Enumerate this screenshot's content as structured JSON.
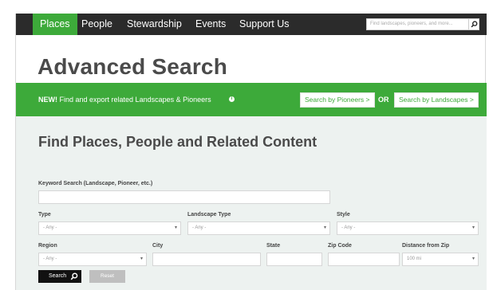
{
  "nav": {
    "items": [
      {
        "label": "Places",
        "active": true
      },
      {
        "label": "People",
        "active": false
      },
      {
        "label": "Stewardship",
        "active": false
      },
      {
        "label": "Events",
        "active": false
      },
      {
        "label": "Support Us",
        "active": false
      }
    ],
    "search_placeholder": "Find landscapes, pioneers, and more..."
  },
  "page_title": "Advanced Search",
  "banner": {
    "new_label": "NEW!",
    "text": " Find and export related Landscapes & Pioneers",
    "pioneers_button": "Search by Pioneers >",
    "or_label": "OR",
    "landscapes_button": "Search by Landscapes >"
  },
  "form": {
    "title": "Find Places, People and Related Content",
    "keyword_label": "Keyword Search (Landscape, Pioneer, etc.)",
    "keyword_value": "",
    "type_label": "Type",
    "type_value": "- Any -",
    "landscape_type_label": "Landscape Type",
    "landscape_type_value": "- Any -",
    "style_label": "Style",
    "style_value": "- Any -",
    "region_label": "Region",
    "region_value": "- Any -",
    "city_label": "City",
    "state_label": "State",
    "zip_label": "Zip Code",
    "distance_label": "Distance from Zip",
    "distance_value": "100 mi",
    "search_button": "Search",
    "reset_button": "Reset"
  },
  "colors": {
    "accent_green": "#3daa3a",
    "nav_bg": "#2b2b2b",
    "form_bg": "#edf2f0"
  }
}
